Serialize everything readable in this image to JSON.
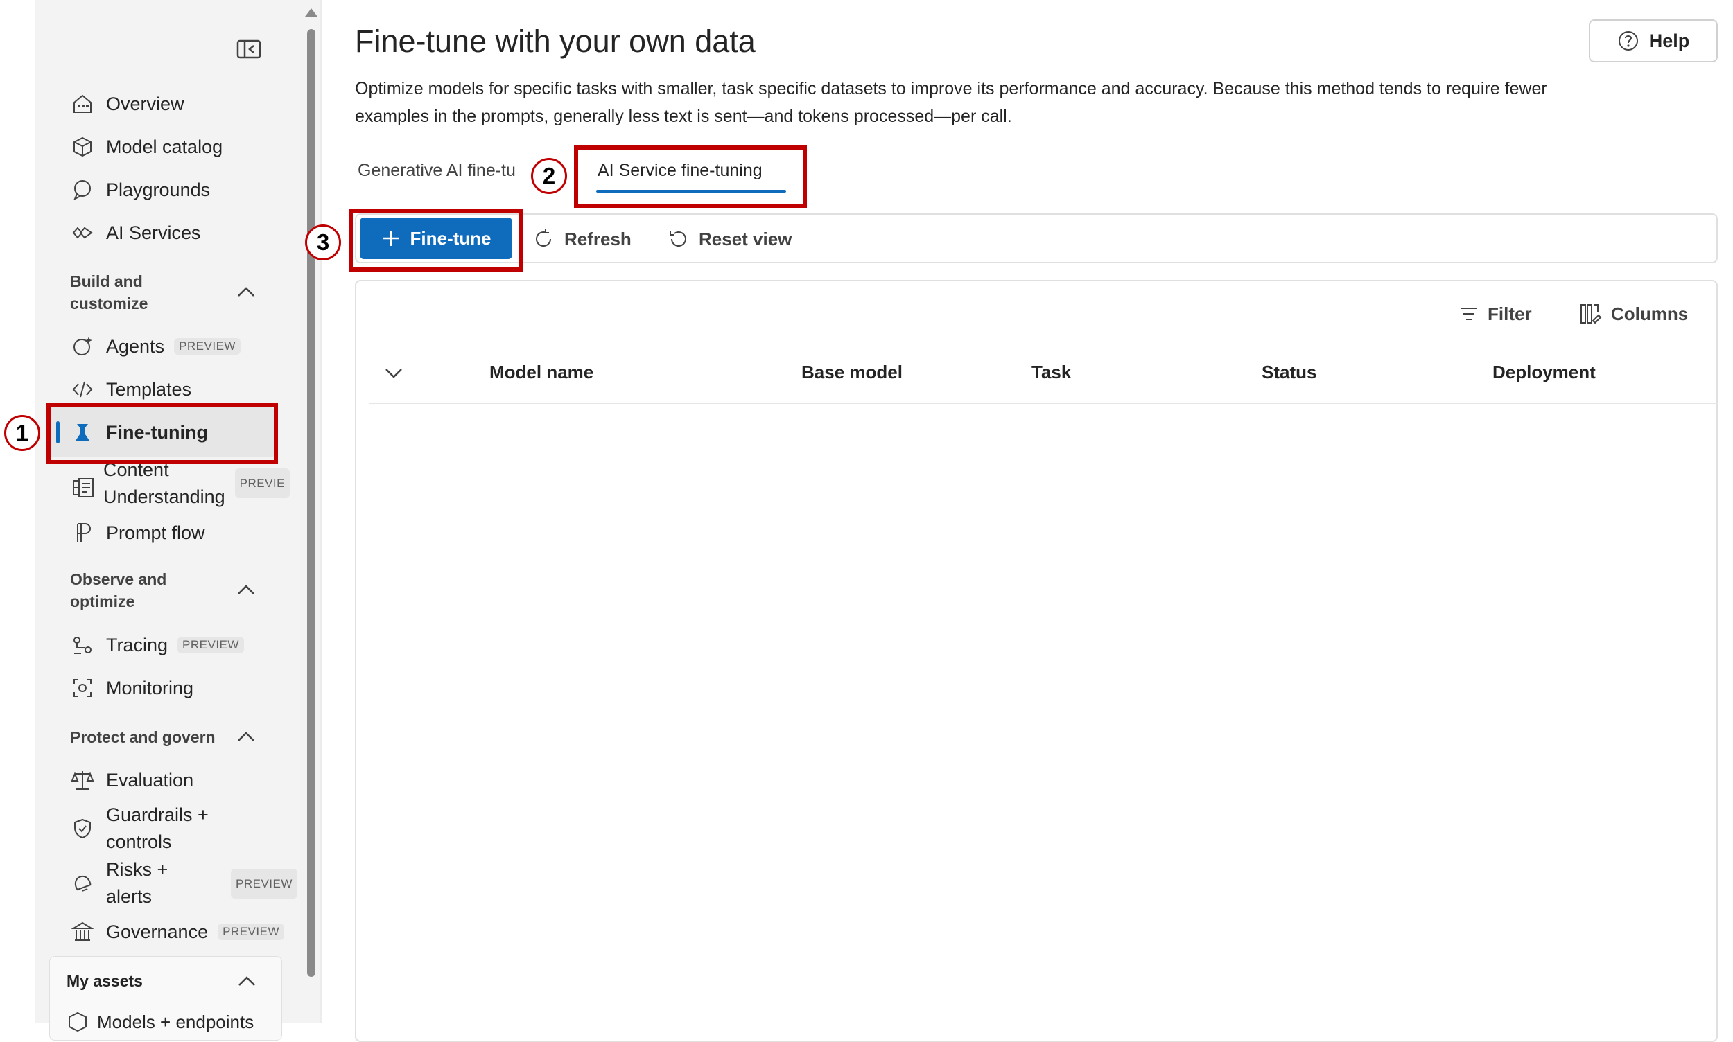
{
  "sidebar": {
    "items": [
      {
        "label": "Overview",
        "icon": "overview-icon"
      },
      {
        "label": "Model catalog",
        "icon": "model-catalog-icon"
      },
      {
        "label": "Playgrounds",
        "icon": "playgrounds-icon"
      },
      {
        "label": "AI Services",
        "icon": "ai-services-icon"
      }
    ],
    "sections": [
      {
        "title_line1": "Build and",
        "title_line2": "customize"
      },
      {
        "title_line1": "Observe and",
        "title_line2": "optimize"
      },
      {
        "title": "Protect and govern"
      }
    ],
    "build": {
      "agents": "Agents",
      "agents_badge": "PREVIEW",
      "templates": "Templates",
      "finetuning": "Fine-tuning",
      "content_line1": "Content",
      "content_line2": "Understanding",
      "content_badge": "PREVIE",
      "promptflow": "Prompt flow"
    },
    "observe": {
      "tracing": "Tracing",
      "tracing_badge": "PREVIEW",
      "monitoring": "Monitoring"
    },
    "protect": {
      "evaluation": "Evaluation",
      "guardrails_line1": "Guardrails +",
      "guardrails_line2": "controls",
      "risks_line1": "Risks +",
      "risks_line2": "alerts",
      "risks_badge": "PREVIEW",
      "governance": "Governance",
      "governance_badge": "PREVIEW"
    },
    "my_assets": {
      "title": "My assets",
      "first_item": "Models + endpoints"
    }
  },
  "main": {
    "title": "Fine-tune with your own data",
    "description": "Optimize models for specific tasks with smaller, task specific datasets to improve its performance and accuracy. Because this method tends to require fewer examples in the prompts, generally less text is sent—and tokens processed—per call.",
    "help": "Help",
    "tabs": [
      {
        "label": "Generative AI fine-tu"
      },
      {
        "label": "AI Service fine-tuning",
        "selected": true
      }
    ],
    "toolbar": {
      "fine_tune": "Fine-tune",
      "refresh": "Refresh",
      "reset_view": "Reset view"
    },
    "grid": {
      "filter": "Filter",
      "columns": "Columns",
      "headers": [
        "Model name",
        "Base model",
        "Task",
        "Status",
        "Deployment"
      ],
      "rows": []
    }
  },
  "callouts": [
    "1",
    "2",
    "3"
  ],
  "colors": {
    "accent": "#0f6cbd",
    "highlight": "#c00000",
    "sidebar_bg": "#f3f3f3"
  }
}
